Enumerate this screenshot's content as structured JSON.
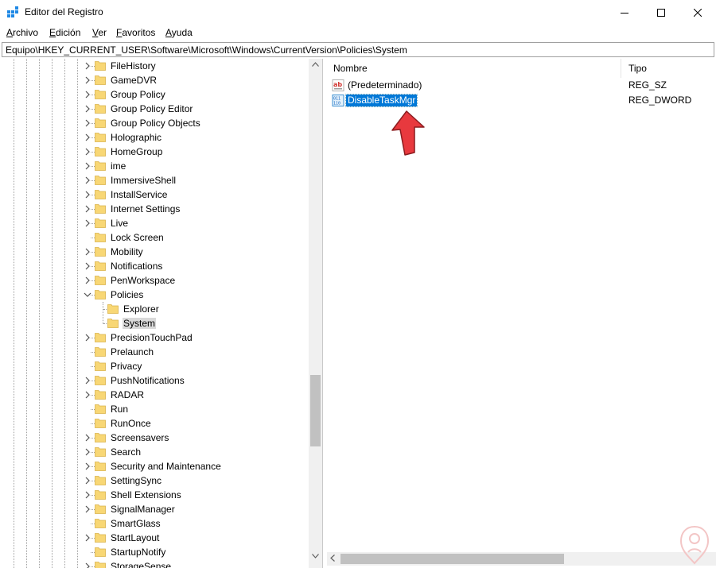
{
  "window": {
    "title": "Editor del Registro",
    "icon": "regedit-icon",
    "controls": [
      "minimize-icon",
      "maximize-icon",
      "close-icon"
    ]
  },
  "menu": [
    {
      "label": "Archivo",
      "accel": "A",
      "rest": "rchivo"
    },
    {
      "label": "Edición",
      "accel": "E",
      "rest": "dición"
    },
    {
      "label": "Ver",
      "accel": "V",
      "rest": "er"
    },
    {
      "label": "Favoritos",
      "accel": "F",
      "rest": "avoritos"
    },
    {
      "label": "Ayuda",
      "accel": "A",
      "rest": "yuda"
    }
  ],
  "address": "Equipo\\HKEY_CURRENT_USER\\Software\\Microsoft\\Windows\\CurrentVersion\\Policies\\System",
  "tree": {
    "items": [
      {
        "label": "FileHistory",
        "expandable": true,
        "level": 0
      },
      {
        "label": "GameDVR",
        "expandable": true,
        "level": 0
      },
      {
        "label": "Group Policy",
        "expandable": true,
        "level": 0
      },
      {
        "label": "Group Policy Editor",
        "expandable": true,
        "level": 0
      },
      {
        "label": "Group Policy Objects",
        "expandable": true,
        "level": 0
      },
      {
        "label": "Holographic",
        "expandable": true,
        "level": 0
      },
      {
        "label": "HomeGroup",
        "expandable": true,
        "level": 0
      },
      {
        "label": "ime",
        "expandable": true,
        "level": 0
      },
      {
        "label": "ImmersiveShell",
        "expandable": true,
        "level": 0
      },
      {
        "label": "InstallService",
        "expandable": true,
        "level": 0
      },
      {
        "label": "Internet Settings",
        "expandable": true,
        "level": 0
      },
      {
        "label": "Live",
        "expandable": true,
        "level": 0
      },
      {
        "label": "Lock Screen",
        "expandable": false,
        "level": 0
      },
      {
        "label": "Mobility",
        "expandable": true,
        "level": 0
      },
      {
        "label": "Notifications",
        "expandable": true,
        "level": 0
      },
      {
        "label": "PenWorkspace",
        "expandable": true,
        "level": 0
      },
      {
        "label": "Policies",
        "expandable": true,
        "expanded": true,
        "level": 0
      },
      {
        "label": "Explorer",
        "expandable": false,
        "level": 1
      },
      {
        "label": "System",
        "expandable": false,
        "level": 1,
        "selected": true
      },
      {
        "label": "PrecisionTouchPad",
        "expandable": true,
        "level": 0
      },
      {
        "label": "Prelaunch",
        "expandable": false,
        "level": 0
      },
      {
        "label": "Privacy",
        "expandable": false,
        "level": 0
      },
      {
        "label": "PushNotifications",
        "expandable": true,
        "level": 0
      },
      {
        "label": "RADAR",
        "expandable": true,
        "level": 0
      },
      {
        "label": "Run",
        "expandable": false,
        "level": 0
      },
      {
        "label": "RunOnce",
        "expandable": false,
        "level": 0
      },
      {
        "label": "Screensavers",
        "expandable": true,
        "level": 0
      },
      {
        "label": "Search",
        "expandable": true,
        "level": 0
      },
      {
        "label": "Security and Maintenance",
        "expandable": true,
        "level": 0
      },
      {
        "label": "SettingSync",
        "expandable": true,
        "level": 0
      },
      {
        "label": "Shell Extensions",
        "expandable": true,
        "level": 0
      },
      {
        "label": "SignalManager",
        "expandable": true,
        "level": 0
      },
      {
        "label": "SmartGlass",
        "expandable": false,
        "level": 0
      },
      {
        "label": "StartLayout",
        "expandable": true,
        "level": 0
      },
      {
        "label": "StartupNotify",
        "expandable": false,
        "level": 0
      },
      {
        "label": "StorageSense",
        "expandable": true,
        "level": 0
      }
    ]
  },
  "values_pane": {
    "columns": [
      {
        "label": "Nombre"
      },
      {
        "label": "Tipo"
      }
    ],
    "rows": [
      {
        "name": "(Predeterminado)",
        "type": "REG_SZ",
        "icon": "string-value-icon"
      },
      {
        "name": "DisableTaskMgr",
        "type": "REG_DWORD",
        "icon": "dword-value-icon",
        "selected": true
      }
    ]
  },
  "colors": {
    "folder": "#f8d775",
    "selection": "#0078d7",
    "tree_selection": "#d9d9d9",
    "pointer_arrow": "#e8393e"
  }
}
